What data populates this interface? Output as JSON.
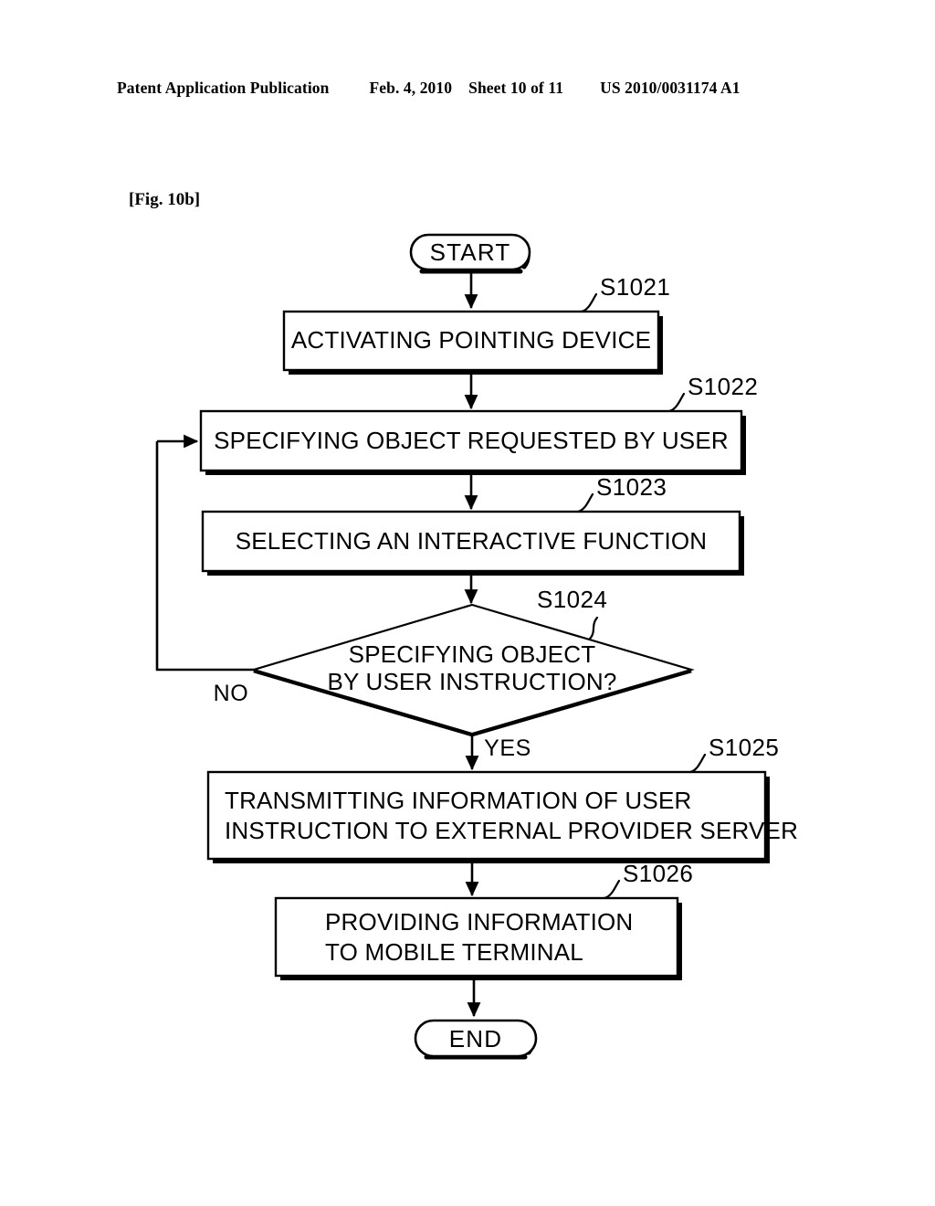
{
  "header": {
    "publication": "Patent Application Publication",
    "date": "Feb. 4, 2010",
    "sheet": "Sheet 10 of 11",
    "document_number": "US 2010/0031174 A1"
  },
  "figure": {
    "label": "[Fig. 10b]"
  },
  "flowchart": {
    "start_label": "START",
    "end_label": "END",
    "branch_no": "NO",
    "branch_yes": "YES",
    "steps": [
      {
        "ref": "S1021",
        "shape": "process",
        "lines": [
          "ACTIVATING POINTING DEVICE"
        ],
        "align": "center"
      },
      {
        "ref": "S1022",
        "shape": "process",
        "lines": [
          "SPECIFYING OBJECT REQUESTED BY USER"
        ],
        "align": "center"
      },
      {
        "ref": "S1023",
        "shape": "process",
        "lines": [
          "SELECTING AN INTERACTIVE FUNCTION"
        ],
        "align": "center"
      },
      {
        "ref": "S1024",
        "shape": "decision",
        "lines": [
          "SPECIFYING OBJECT",
          "BY USER INSTRUCTION?"
        ],
        "align": "center"
      },
      {
        "ref": "S1025",
        "shape": "process",
        "lines": [
          "TRANSMITTING INFORMATION OF USER",
          "INSTRUCTION TO EXTERNAL PROVIDER SERVER"
        ],
        "align": "left"
      },
      {
        "ref": "S1026",
        "shape": "process",
        "lines": [
          "PROVIDING INFORMATION",
          "TO MOBILE TERMINAL"
        ],
        "align": "left"
      }
    ]
  },
  "colors": {
    "ink": "#000000",
    "paper": "#ffffff"
  }
}
